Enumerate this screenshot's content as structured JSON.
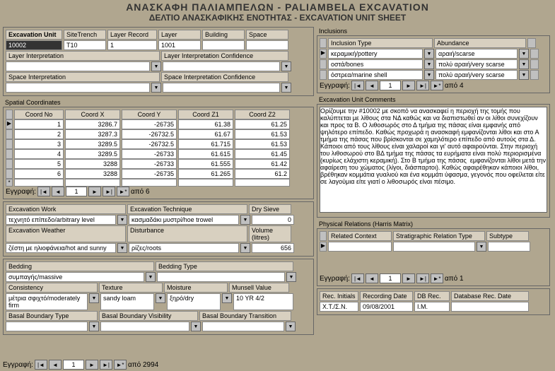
{
  "header": {
    "title1": "ΑΝΑΣΚΑΦΗ ΠΑΛΙΑΜΠΕΛΩΝ - PALIAMBELA EXCAVATION",
    "title2": "ΔΕΛΤΙΟ ΑΝΑΣΚΑΦΙΚΗΣ ΕΝΟΤΗΤΑΣ - EXCAVATION UNIT SHEET"
  },
  "unit": {
    "h1": "Excavation Unit",
    "h2": "SiteTrench",
    "h3": "Layer Record",
    "h4": "Layer",
    "h5": "Building",
    "h6": "Space",
    "v1": "10002",
    "v2": "T10",
    "v3": "1",
    "v4": "1001",
    "v5": "",
    "v6": ""
  },
  "layerInt": {
    "l1": "Layer Interpretation",
    "l2": "Layer Interpretation Confidence"
  },
  "spaceInt": {
    "l1": "Space Interpretation",
    "l2": "Space Interpretation Confidence"
  },
  "coords": {
    "title": "Spatial Coordinates",
    "h0": "Coord No",
    "h1": "Coord X",
    "h2": "Coord Y",
    "h3": "Coord Z1",
    "h4": "Coord Z2",
    "rows": [
      {
        "n": "1",
        "x": "3286.7",
        "y": "-26735",
        "z1": "61.38",
        "z2": "61.25"
      },
      {
        "n": "2",
        "x": "3287.3",
        "y": "-26732.5",
        "z1": "61.67",
        "z2": "61.53"
      },
      {
        "n": "3",
        "x": "3289.5",
        "y": "-26732.5",
        "z1": "61.715",
        "z2": "61.53"
      },
      {
        "n": "4",
        "x": "3289.5",
        "y": "-26733",
        "z1": "61.615",
        "z2": "61.45"
      },
      {
        "n": "5",
        "x": "3288",
        "y": "-26733",
        "z1": "61.555",
        "z2": "61.42"
      },
      {
        "n": "6",
        "x": "3288",
        "y": "-26735",
        "z1": "61.265",
        "z2": "61.2"
      }
    ],
    "navlabel": "Εγγραφή:",
    "count": "από  6"
  },
  "work": {
    "l1": "Excavation Work",
    "l2": "Excavation Technique",
    "l3": "Dry Sieve",
    "v1": "τεχνητό επίπεδο/arbitrary level",
    "v2": "κασμαδάκι μυστρί/hoe trowel",
    "v3": "0"
  },
  "weather": {
    "l1": "Excavation Weather",
    "l2": "Disturbance",
    "l3": "Volume (litres)",
    "v1": "ζέστη με ηλιοφάνεια/hot and sunny",
    "v2": "ρίζες/roots",
    "v3": "656"
  },
  "bed": {
    "l1": "Bedding",
    "l2": "Bedding Type",
    "v1": "συμπαγής/massive"
  },
  "cons": {
    "l1": "Consistency",
    "l2": "Texture",
    "l3": "Moisture",
    "l4": "Munsell Value",
    "v1": "μέτρια σφιχτό/moderately firm",
    "v2": "sandy loam",
    "v3": "ξηρό/dry",
    "v4": "10 YR 4/2"
  },
  "basal": {
    "l1": "Basal Boundary Type",
    "l2": "Basal Boundary Visibility",
    "l3": "Basal Boundary Transition"
  },
  "incl": {
    "title": "Inclusions",
    "h1": "Inclusion Type",
    "h2": "Abundance",
    "rows": [
      {
        "t": "κεραμική/pottery",
        "a": "αραιή/scarse"
      },
      {
        "t": "οστά/bones",
        "a": "πολύ αραιή/very scarse"
      },
      {
        "t": "όστρεα/marine shell",
        "a": "πολύ αραιή/very scarse"
      }
    ],
    "navlabel": "Εγγραφή:",
    "count": "από  4"
  },
  "comments": {
    "title": "Excavation Unit Comments",
    "text": "Ορίζουμε την #10002 με σκοπό να ανασκαφεί η περιοχή της τομής που καλύπτεται με λίθους στα ΝΔ καθώς και να διαπιστωθεί αν οι λίθοι συνεχίζουν και προς τα Β. Ο λιθοσωρός στο Δ τμήμα της πάσας είναι εμφανής από ψηλότερο επίπεδο. Καθώς προχωρά η ανασκαφή εμφανίζονται λίθοι και στο Α τμήμα της πάσας που βρίσκονται σε χαμηλότερο επίπεδο από αυτούς στα Δ. Κάποιοι από τους λίθους είναι χαλαροί και γι' αυτό αφαιρούνται. Στην περιοχή του λιθοσωρού στο ΒΔ τμήμα της πάσας τα ευρήματα είναι πολύ περιορισμένα (κυρίως ελάχιστη κεραμική). Στο Β τμήμα της πάσας  εμφανίζονται λίθοι μετά την αφαίρεση του χώματος (λίγοι, διάσπαρτοι). Καθώς αφαιρέθηκαν κάποιοι λίθοι, βρέθηκαν κομμάτια γυαλιού και ένα κομμάτι ύφασμα, γεγονός που οφείλεται είτε σε λαγούμια είτε γιατί ο λιθοσωρός είναι πέσιμο."
  },
  "phys": {
    "title": "Physical Relations (Harris Matrix)",
    "h1": "Related Context",
    "h2": "Stratigraphic Relation Type",
    "h3": "Subtype",
    "navlabel": "Εγγραφή:",
    "count": "από  1"
  },
  "rec": {
    "h1": "Rec. Initials",
    "h2": "Recording Date",
    "h3": "DB Rec.",
    "h4": "Database Rec. Date",
    "v1": "Χ.Τ./Σ.Ν.",
    "v2": "09/08/2001",
    "v3": "Ι.Μ.",
    "v4": ""
  },
  "footer": {
    "navlabel": "Εγγραφή:",
    "page": "1",
    "count": "από  2994"
  }
}
